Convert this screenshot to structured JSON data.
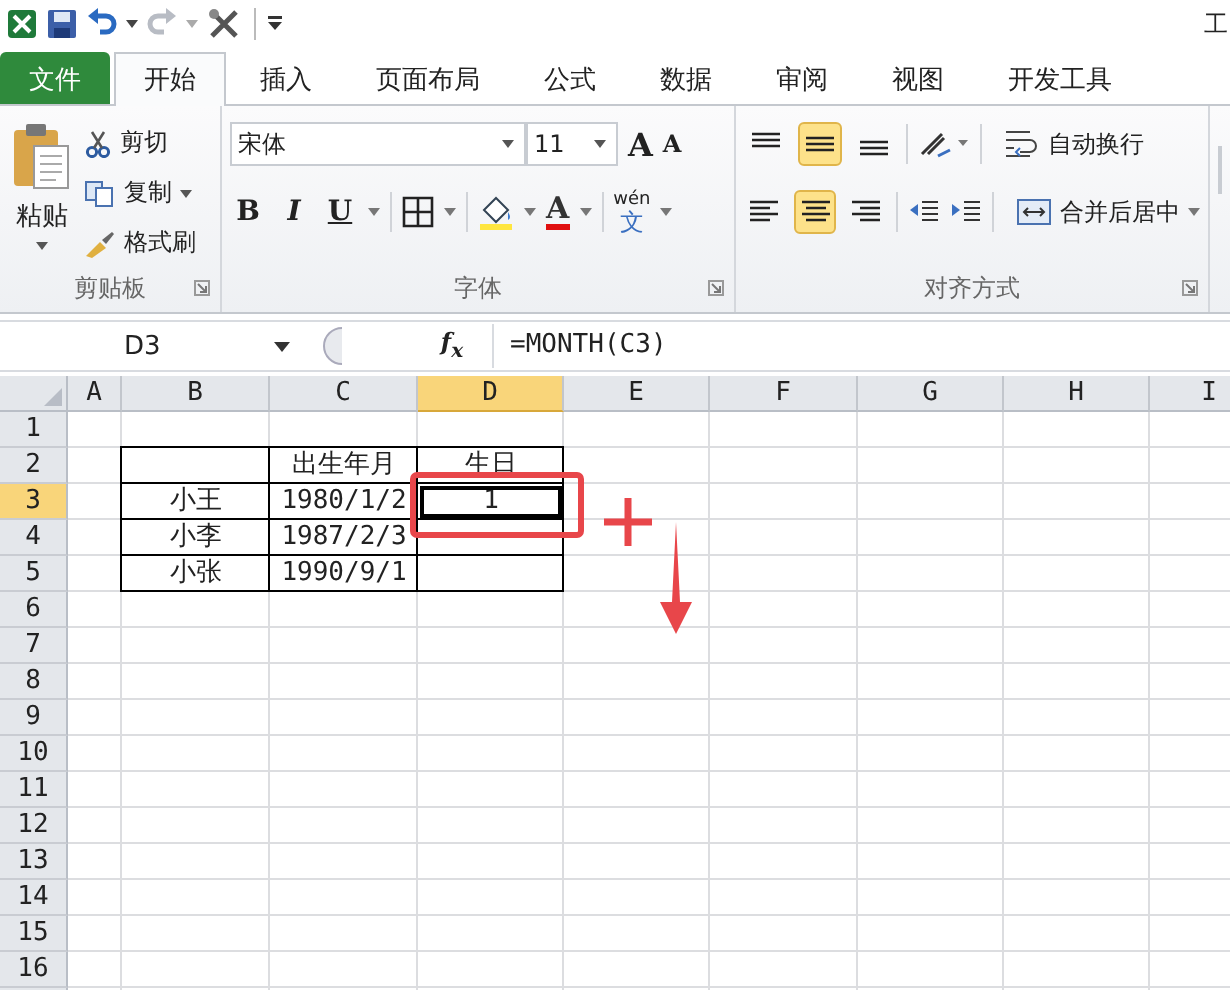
{
  "window": {
    "title": "工"
  },
  "tabs": [
    {
      "label": "文件",
      "kind": "file",
      "selected": false
    },
    {
      "label": "开始",
      "kind": "tab",
      "selected": true
    },
    {
      "label": "插入",
      "kind": "tab",
      "selected": false
    },
    {
      "label": "页面布局",
      "kind": "tab",
      "selected": false
    },
    {
      "label": "公式",
      "kind": "tab",
      "selected": false
    },
    {
      "label": "数据",
      "kind": "tab",
      "selected": false
    },
    {
      "label": "审阅",
      "kind": "tab",
      "selected": false
    },
    {
      "label": "视图",
      "kind": "tab",
      "selected": false
    },
    {
      "label": "开发工具",
      "kind": "tab",
      "selected": false
    }
  ],
  "clipboard": {
    "paste": "粘贴",
    "cut": "剪切",
    "copy": "复制",
    "format_painter": "格式刷",
    "label": "剪贴板"
  },
  "font": {
    "name": "宋体",
    "size": "11",
    "grow": "A",
    "shrink": "A",
    "bold": "B",
    "italic": "I",
    "underline": "U",
    "font_color": "A",
    "phonetic_top": "wén",
    "phonetic_bottom": "文",
    "label": "字体"
  },
  "alignment": {
    "vertical": [
      {
        "selected": false
      },
      {
        "selected": true
      },
      {
        "selected": false
      }
    ],
    "horizontal": [
      {
        "selected": false
      },
      {
        "selected": true
      },
      {
        "selected": false
      }
    ],
    "wrap_text": "自动换行",
    "merge_center": "合并后居中",
    "label": "对齐方式"
  },
  "formula_bar": {
    "name_box": "D3",
    "fx": "f$_{x}$",
    "formula": "=MONTH(C3)"
  },
  "sheet": {
    "columns": [
      {
        "label": "A",
        "selected": false
      },
      {
        "label": "B",
        "selected": false
      },
      {
        "label": "C",
        "selected": false
      },
      {
        "label": "D",
        "selected": true
      },
      {
        "label": "E",
        "selected": false
      },
      {
        "label": "F",
        "selected": false
      },
      {
        "label": "G",
        "selected": false
      },
      {
        "label": "H",
        "selected": false
      },
      {
        "label": "I",
        "selected": false
      }
    ],
    "rows": [
      {
        "label": "1",
        "selected": false
      },
      {
        "label": "2",
        "selected": false
      },
      {
        "label": "3",
        "selected": true
      },
      {
        "label": "4",
        "selected": false
      },
      {
        "label": "5",
        "selected": false
      },
      {
        "label": "6",
        "selected": false
      },
      {
        "label": "7",
        "selected": false
      },
      {
        "label": "8",
        "selected": false
      },
      {
        "label": "9",
        "selected": false
      },
      {
        "label": "10",
        "selected": false
      },
      {
        "label": "11",
        "selected": false
      },
      {
        "label": "12",
        "selected": false
      },
      {
        "label": "13",
        "selected": false
      },
      {
        "label": "14",
        "selected": false
      },
      {
        "label": "15",
        "selected": false
      },
      {
        "label": "16",
        "selected": false
      }
    ],
    "table": {
      "header": {
        "birth": "出生年月",
        "birthday": "生日"
      },
      "rows": [
        {
          "name": "小王",
          "birth": "1980/1/2",
          "birthday": "1"
        },
        {
          "name": "小李",
          "birth": "1987/2/3"
        },
        {
          "name": "小张",
          "birth": "1990/9/1"
        }
      ]
    }
  }
}
